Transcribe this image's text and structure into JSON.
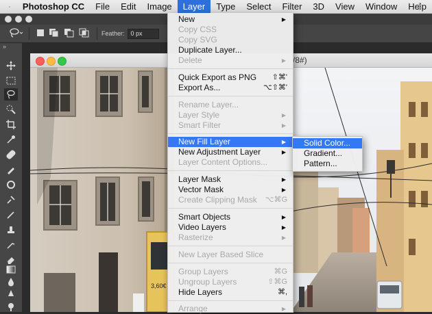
{
  "menubar": {
    "app": "Photoshop CC",
    "items": [
      "File",
      "Edit",
      "Image",
      "Layer",
      "Type",
      "Select",
      "Filter",
      "3D",
      "View",
      "Window",
      "Help"
    ],
    "active": "Layer"
  },
  "options_bar": {
    "feather_label": "Feather:",
    "feather_value": "0 px"
  },
  "document": {
    "title_fragment": "/8#)"
  },
  "layer_menu": {
    "new": "New",
    "copy_css": "Copy CSS",
    "copy_svg": "Copy SVG",
    "duplicate_layer": "Duplicate Layer...",
    "delete": "Delete",
    "quick_export": "Quick Export as PNG",
    "quick_export_sc": "⇧⌘'",
    "export_as": "Export As...",
    "export_as_sc": "⌥⇧⌘'",
    "rename_layer": "Rename Layer...",
    "layer_style": "Layer Style",
    "smart_filter": "Smart Filter",
    "new_fill_layer": "New Fill Layer",
    "new_adjustment_layer": "New Adjustment Layer",
    "layer_content_options": "Layer Content Options...",
    "layer_mask": "Layer Mask",
    "vector_mask": "Vector Mask",
    "create_clipping_mask": "Create Clipping Mask",
    "create_clipping_mask_sc": "⌥⌘G",
    "smart_objects": "Smart Objects",
    "video_layers": "Video Layers",
    "rasterize": "Rasterize",
    "new_layer_based_slice": "New Layer Based Slice",
    "group_layers": "Group Layers",
    "group_layers_sc": "⌘G",
    "ungroup_layers": "Ungroup Layers",
    "ungroup_layers_sc": "⇧⌘G",
    "hide_layers": "Hide Layers",
    "hide_layers_sc": "⌘,",
    "arrange": "Arrange"
  },
  "fill_submenu": {
    "solid_color": "Solid Color...",
    "gradient": "Gradient...",
    "pattern": "Pattern..."
  },
  "colors": {
    "menu_highlight": "#3478f6",
    "menubar_active": "#2e6fdb",
    "ps_dark": "#464646"
  }
}
